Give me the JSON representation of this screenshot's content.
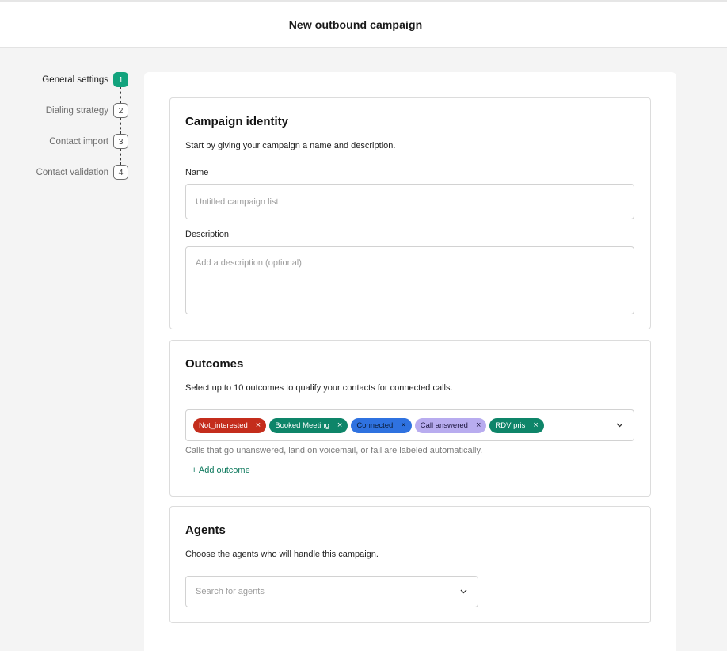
{
  "header": {
    "title": "New outbound campaign"
  },
  "stepper": {
    "steps": [
      {
        "label": "General settings",
        "number": "1",
        "active": true
      },
      {
        "label": "Dialing strategy",
        "number": "2",
        "active": false
      },
      {
        "label": "Contact import",
        "number": "3",
        "active": false
      },
      {
        "label": "Contact validation",
        "number": "4",
        "active": false
      }
    ]
  },
  "identity": {
    "title": "Campaign identity",
    "subtitle": "Start by giving your campaign a name and description.",
    "name_label": "Name",
    "name_placeholder": "Untitled campaign list",
    "name_value": "",
    "description_label": "Description",
    "description_placeholder": "Add a description (optional)",
    "description_value": ""
  },
  "outcomes": {
    "title": "Outcomes",
    "subtitle": "Select up to 10 outcomes to qualify your contacts for connected calls.",
    "chips": [
      {
        "label": "Not_interested",
        "bg": "#c42d1c",
        "fg": "#ffffff",
        "x_color": "#ffffff"
      },
      {
        "label": "Booked Meeting",
        "bg": "#0e8569",
        "fg": "#ffffff",
        "x_color": "#ffffff"
      },
      {
        "label": "Connected",
        "bg": "#2f72e0",
        "fg": "#0b1d3a",
        "x_color": "#0b1d3a"
      },
      {
        "label": "Call answered",
        "bg": "#b8acef",
        "fg": "#1d1640",
        "x_color": "#1d1640"
      },
      {
        "label": "RDV pris",
        "bg": "#0e8569",
        "fg": "#ffffff",
        "x_color": "#ffffff"
      }
    ],
    "remove_icon": "×",
    "hint": "Calls that go unanswered, land on voicemail, or fail are labeled automatically.",
    "add_label": "+ Add outcome"
  },
  "agents": {
    "title": "Agents",
    "subtitle": "Choose the agents who will handle this campaign.",
    "search_placeholder": "Search for agents"
  },
  "colors": {
    "accent": "#12a37d",
    "link": "#0f7a5e",
    "background": "#f4f4f4"
  }
}
